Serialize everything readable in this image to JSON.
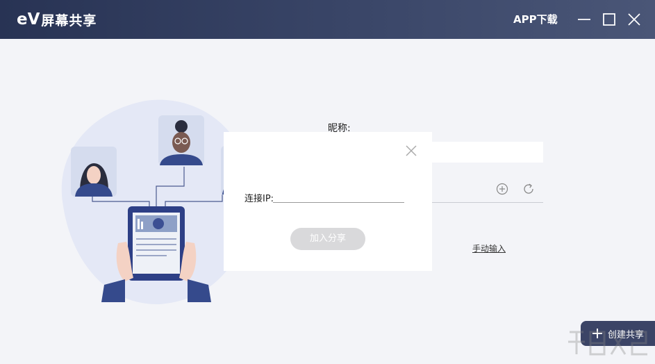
{
  "titlebar": {
    "logo_ev": "eV",
    "logo_name": "屏幕共享",
    "app_download": "APP下载"
  },
  "form": {
    "nickname_label": "昵称:",
    "nickname_value": "",
    "manual_input": "手动输入"
  },
  "dialog": {
    "ip_label": "连接IP:",
    "ip_value": "",
    "join_button": "加入分享"
  },
  "create_share": "创建共享",
  "colors": {
    "titlebar_start": "#283354",
    "titlebar_end": "#4a5677",
    "accent_dark": "#3b4466",
    "background": "#f3f4f8",
    "button_disabled": "#d9d9db"
  },
  "icons": [
    "minimize-icon",
    "maximize-icon",
    "close-icon",
    "add-circle-icon",
    "refresh-icon",
    "dialog-close-icon",
    "plus-icon"
  ]
}
